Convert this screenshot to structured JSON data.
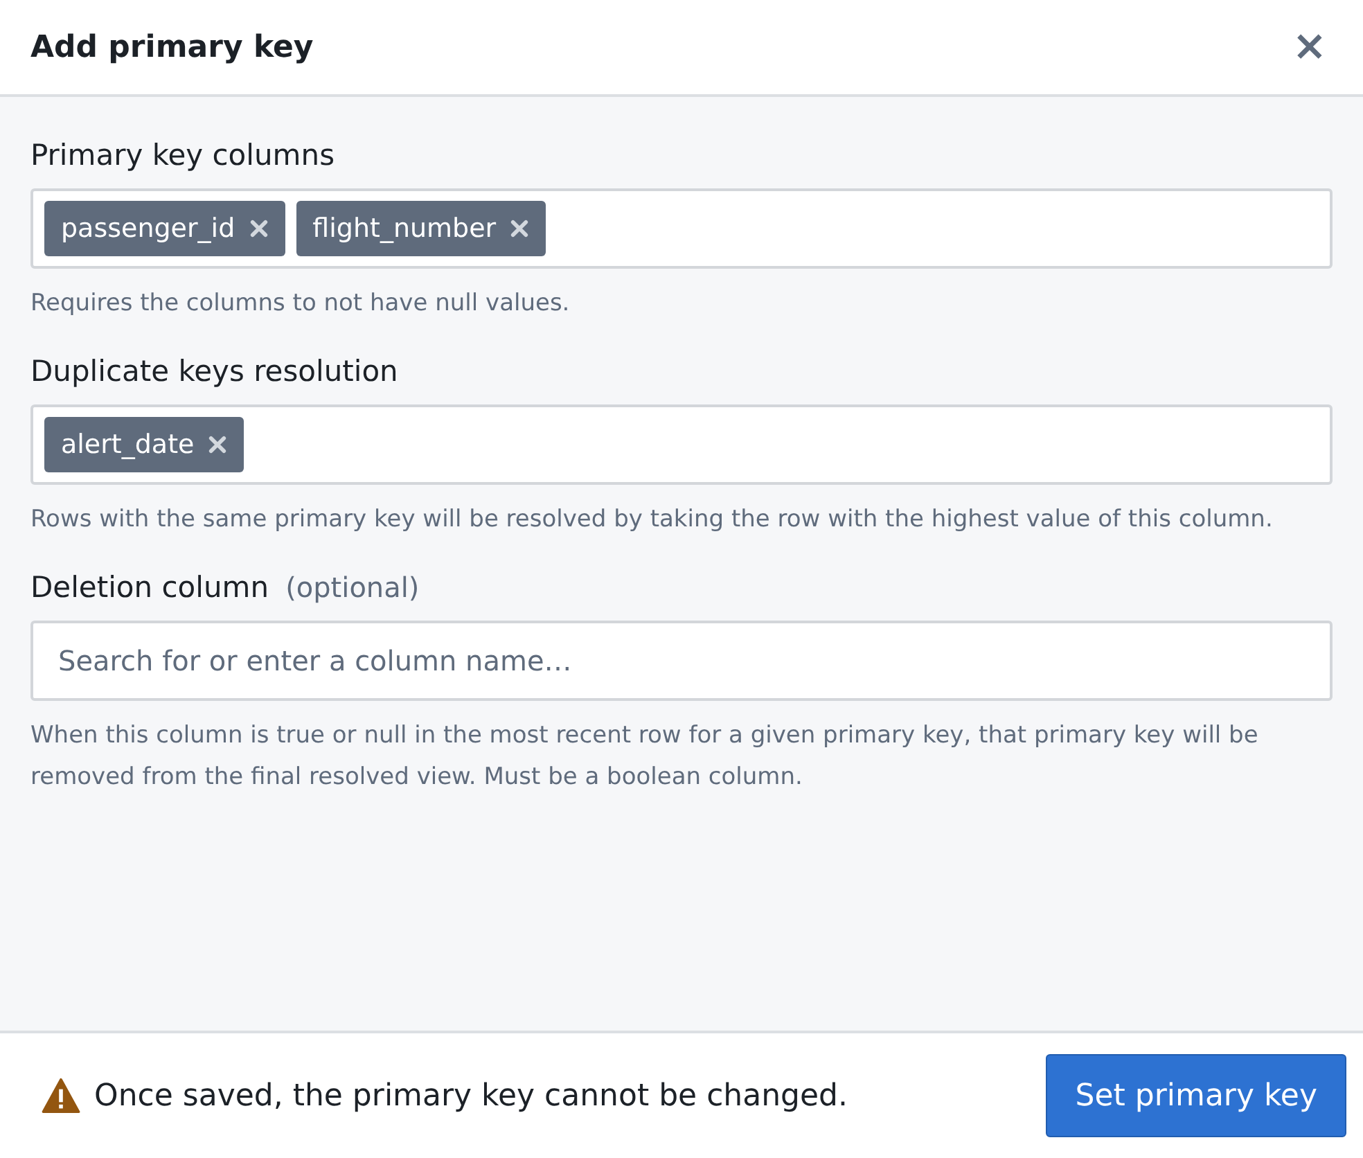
{
  "dialog": {
    "title": "Add primary key",
    "close": "×"
  },
  "fields": [
    {
      "label": "Primary key columns",
      "tags": [
        "passenger_id",
        "flight_number"
      ],
      "help": "Requires the columns to not have null values."
    },
    {
      "label": "Duplicate keys resolution",
      "tags": [
        "alert_date"
      ],
      "help": "Rows with the same primary key will be resolved by taking the row with the highest value of this column."
    },
    {
      "label": "Deletion column",
      "optional": "(optional)",
      "placeholder": "Search for or enter a column name…",
      "help": "When this column is true or null in the most recent row for a given primary key, that primary key will be removed from the final resolved view. Must be a boolean column."
    }
  ],
  "footer": {
    "warning": "Once saved, the primary key cannot be changed.",
    "button": "Set primary key"
  }
}
